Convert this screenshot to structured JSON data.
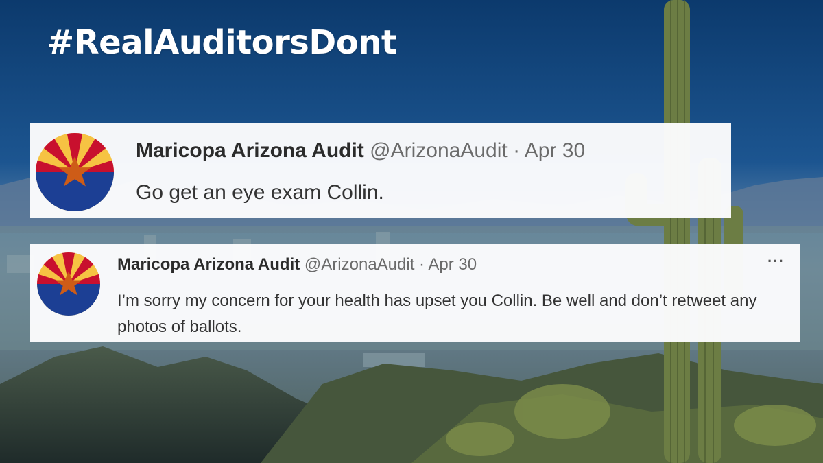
{
  "headline": "#RealAuditorsDont",
  "colors": {
    "sky": "#0f3f72",
    "flag_red": "#c8102e",
    "flag_yellow": "#f6c343",
    "flag_blue": "#1c3f94",
    "flag_copper": "#ce5c17",
    "text_secondary": "#6b6b6b"
  },
  "tweets": [
    {
      "name": "Maricopa Arizona Audit",
      "handle": "@ArizonaAudit",
      "separator": "·",
      "date": "Apr 30",
      "text": "Go get an eye exam Collin.",
      "avatar_icon": "arizona-flag-icon"
    },
    {
      "name": "Maricopa Arizona Audit",
      "handle": "@ArizonaAudit",
      "separator": "·",
      "date": "Apr 30",
      "text": "I’m sorry my concern for your health has upset you Collin. Be well and don’t retweet any photos of ballots.",
      "avatar_icon": "arizona-flag-icon",
      "more_label": "···",
      "more_icon": "more-options-icon"
    }
  ]
}
